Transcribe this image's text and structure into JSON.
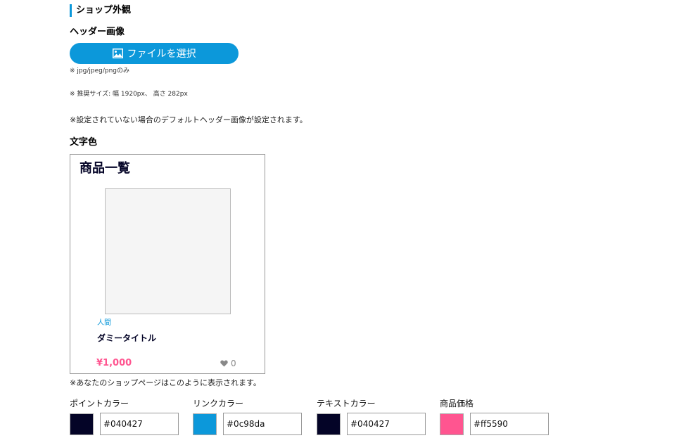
{
  "section": {
    "title": "ショップ外観"
  },
  "header_image": {
    "label": "ヘッダー画像",
    "button_label": "ファイルを選択",
    "note_formats": "※ jpg/jpeg/pngのみ",
    "note_size": "※ 推奨サイズ: 幅 1920px、 高さ 282px",
    "note_default": "※設定されていない場合のデフォルトヘッダー画像が設定されます。"
  },
  "text_color": {
    "label": "文字色"
  },
  "preview": {
    "title": "商品一覧",
    "category": "人間",
    "item_title": "ダミータイトル",
    "price": "¥1,000",
    "likes": "0",
    "note": "※あなたのショップページはこのように表示されます。"
  },
  "colors": [
    {
      "label": "ポイントカラー",
      "value": "#040427"
    },
    {
      "label": "リンクカラー",
      "value": "#0c98da"
    },
    {
      "label": "テキストカラー",
      "value": "#040427"
    },
    {
      "label": "商品価格",
      "value": "#ff5590"
    }
  ]
}
